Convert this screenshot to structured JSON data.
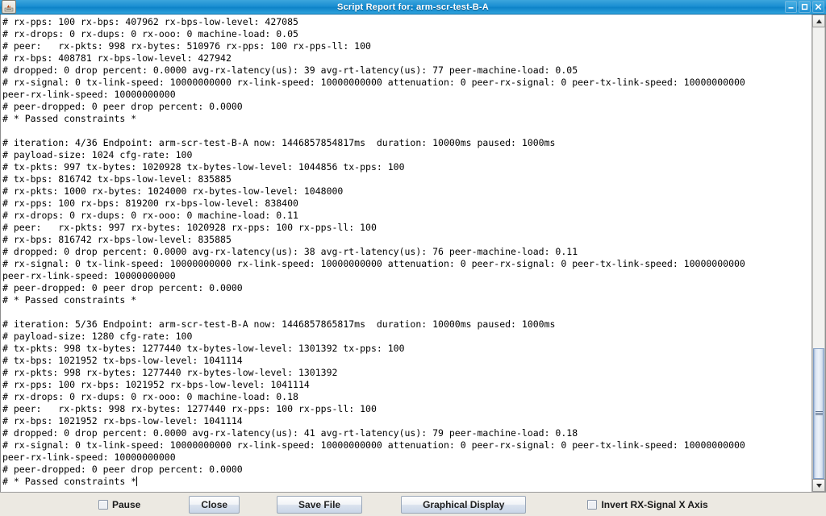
{
  "window": {
    "title": "Script Report for: arm-scr-test-B-A",
    "app_icon": "java-app-icon",
    "minimize_label": "–",
    "maximize_label": "□",
    "close_label": "✕"
  },
  "log": {
    "lines": [
      "# rx-pps: 100 rx-bps: 407962 rx-bps-low-level: 427085",
      "# rx-drops: 0 rx-dups: 0 rx-ooo: 0 machine-load: 0.05",
      "# peer:   rx-pkts: 998 rx-bytes: 510976 rx-pps: 100 rx-pps-ll: 100",
      "# rx-bps: 408781 rx-bps-low-level: 427942",
      "# dropped: 0 drop percent: 0.0000 avg-rx-latency(us): 39 avg-rt-latency(us): 77 peer-machine-load: 0.05",
      "# rx-signal: 0 tx-link-speed: 10000000000 rx-link-speed: 10000000000 attenuation: 0 peer-rx-signal: 0 peer-tx-link-speed: 10000000000",
      "peer-rx-link-speed: 10000000000",
      "# peer-dropped: 0 peer drop percent: 0.0000",
      "# * Passed constraints *",
      "",
      "# iteration: 4/36 Endpoint: arm-scr-test-B-A now: 1446857854817ms  duration: 10000ms paused: 1000ms",
      "# payload-size: 1024 cfg-rate: 100",
      "# tx-pkts: 997 tx-bytes: 1020928 tx-bytes-low-level: 1044856 tx-pps: 100",
      "# tx-bps: 816742 tx-bps-low-level: 835885",
      "# rx-pkts: 1000 rx-bytes: 1024000 rx-bytes-low-level: 1048000",
      "# rx-pps: 100 rx-bps: 819200 rx-bps-low-level: 838400",
      "# rx-drops: 0 rx-dups: 0 rx-ooo: 0 machine-load: 0.11",
      "# peer:   rx-pkts: 997 rx-bytes: 1020928 rx-pps: 100 rx-pps-ll: 100",
      "# rx-bps: 816742 rx-bps-low-level: 835885",
      "# dropped: 0 drop percent: 0.0000 avg-rx-latency(us): 38 avg-rt-latency(us): 76 peer-machine-load: 0.11",
      "# rx-signal: 0 tx-link-speed: 10000000000 rx-link-speed: 10000000000 attenuation: 0 peer-rx-signal: 0 peer-tx-link-speed: 10000000000",
      "peer-rx-link-speed: 10000000000",
      "# peer-dropped: 0 peer drop percent: 0.0000",
      "# * Passed constraints *",
      "",
      "# iteration: 5/36 Endpoint: arm-scr-test-B-A now: 1446857865817ms  duration: 10000ms paused: 1000ms",
      "# payload-size: 1280 cfg-rate: 100",
      "# tx-pkts: 998 tx-bytes: 1277440 tx-bytes-low-level: 1301392 tx-pps: 100",
      "# tx-bps: 1021952 tx-bps-low-level: 1041114",
      "# rx-pkts: 998 rx-bytes: 1277440 rx-bytes-low-level: 1301392",
      "# rx-pps: 100 rx-bps: 1021952 rx-bps-low-level: 1041114",
      "# rx-drops: 0 rx-dups: 0 rx-ooo: 0 machine-load: 0.18",
      "# peer:   rx-pkts: 998 rx-bytes: 1277440 rx-pps: 100 rx-pps-ll: 100",
      "# rx-bps: 1021952 rx-bps-low-level: 1041114",
      "# dropped: 0 drop percent: 0.0000 avg-rx-latency(us): 41 avg-rt-latency(us): 79 peer-machine-load: 0.18",
      "# rx-signal: 0 tx-link-speed: 10000000000 rx-link-speed: 10000000000 attenuation: 0 peer-rx-signal: 0 peer-tx-link-speed: 10000000000",
      "peer-rx-link-speed: 10000000000",
      "# peer-dropped: 0 peer drop percent: 0.0000"
    ],
    "last_line": "# * Passed constraints *"
  },
  "scrollbar": {
    "up_arrow": "▲",
    "down_arrow": "▼",
    "thumb_top_pct": 71,
    "thumb_height_pct": 29
  },
  "toolbar": {
    "pause_label": "Pause",
    "pause_checked": false,
    "close_label": "Close",
    "save_file_label": "Save File",
    "graphical_display_label": "Graphical Display",
    "invert_label": "Invert RX-Signal X Axis",
    "invert_checked": false
  },
  "colors": {
    "titlebar_accent": "#1b8fd2",
    "text_bg": "#ffffff",
    "toolbar_bg": "#ece9e2",
    "scroll_thumb": "#c9d9ee"
  }
}
